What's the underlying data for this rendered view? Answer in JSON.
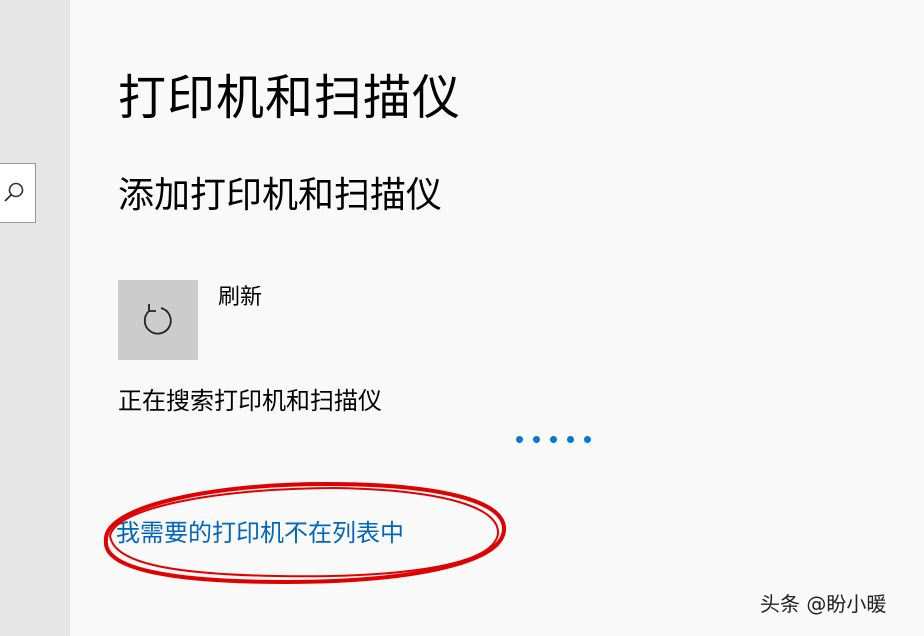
{
  "sidebar": {
    "search_icon": "search-icon"
  },
  "main": {
    "page_title": "打印机和扫描仪",
    "section_title": "添加打印机和扫描仪",
    "refresh": {
      "icon": "refresh-icon",
      "label": "刷新"
    },
    "searching_text": "正在搜索打印机和扫描仪",
    "missing_printer_link": "我需要的打印机不在列表中"
  },
  "watermark": "头条 @盼小暖",
  "colors": {
    "link": "#0067c0",
    "progress": "#0078d7",
    "annotation": "#e00000",
    "sidebar": "#e6e6e6",
    "tile": "#cccccc"
  }
}
